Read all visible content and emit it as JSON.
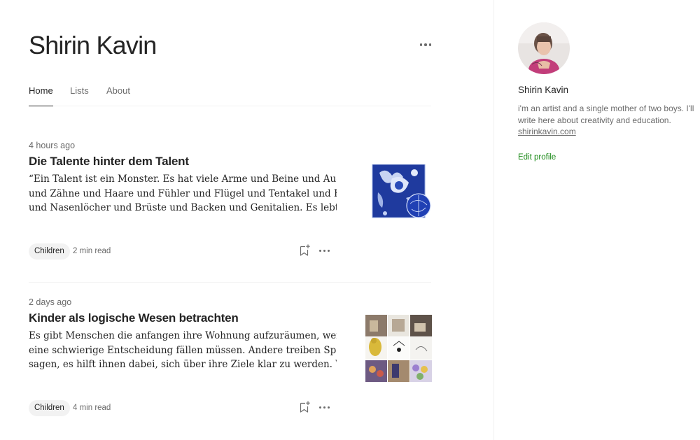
{
  "profile": {
    "name": "Shirin Kavin"
  },
  "tabs": [
    {
      "label": "Home",
      "active": true
    },
    {
      "label": "Lists",
      "active": false
    },
    {
      "label": "About",
      "active": false
    }
  ],
  "articles": [
    {
      "time": "4 hours ago",
      "title": "Die Talente hinter dem Talent",
      "excerpt_lines": [
        "“Ein Talent ist ein Monster. Es hat viele Arme und Beine und Augen",
        "und Zähne und Haare und Fühler und Flügel und Tentakel und Hörner",
        "und Nasenlöcher und Brüste und Backen und Genitalien. Es lebt in u…"
      ],
      "tag": "Children",
      "read_time": "2 min read"
    },
    {
      "time": "2 days ago",
      "title": "Kinder als logische Wesen betrachten",
      "excerpt_lines": [
        "Es gibt Menschen die anfangen ihre Wohnung aufzuräumen, wenn sie",
        "eine schwierige Entscheidung fällen müssen. Andere treiben Sport und",
        "sagen, es hilft ihnen dabei, sich über ihre Ziele klar zu werden. Wir…"
      ],
      "tag": "Children",
      "read_time": "4 min read"
    }
  ],
  "sidebar": {
    "name": "Shirin Kavin",
    "bio_lines": [
      "i'm an artist and a single mother of two boys. I'll",
      "write here about creativity and education."
    ],
    "link": "shirinkavin.com",
    "edit_profile": "Edit profile"
  },
  "icons": {
    "more": "more-horizontal-icon",
    "save": "bookmark-plus-icon"
  },
  "colors": {
    "text": "#242424",
    "muted": "#6b6b6b",
    "accent": "#1a8917",
    "tag_bg": "#f2f2f2"
  }
}
